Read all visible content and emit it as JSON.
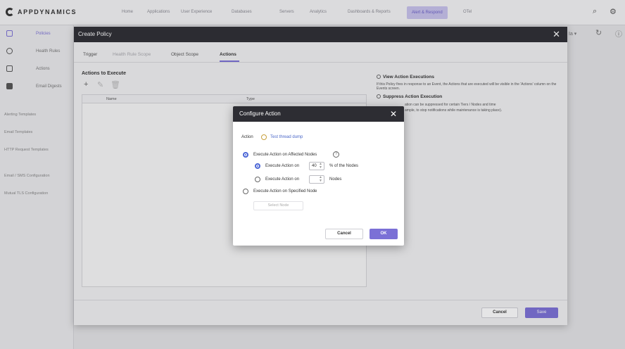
{
  "brand": {
    "name": "APPDYNAMICS"
  },
  "nav": {
    "items": [
      "Home",
      "Applications",
      "User Experience",
      "Databases",
      "Servers",
      "Analytics",
      "Dashboards & Reports",
      "Alert & Respond",
      "OTel"
    ],
    "active": "Alert & Respond",
    "icons": [
      "search-icon",
      "gear-icon"
    ]
  },
  "sidebar": {
    "items": [
      {
        "label": "Policies",
        "icon": "policies-icon",
        "active": true
      },
      {
        "label": "Health Rules",
        "icon": "health-rules-icon"
      },
      {
        "label": "Actions",
        "icon": "actions-icon"
      },
      {
        "label": "Email Digests",
        "icon": "email-digests-icon"
      }
    ],
    "links": [
      "Alerting Templates",
      "Email Templates",
      "HTTP Request Templates",
      "Email / SMS Configuration",
      "Mutual TLS Configuration"
    ],
    "collapse_label": "←"
  },
  "background": {
    "fragment_left": "Ia ▾"
  },
  "create_policy": {
    "title": "Create Policy",
    "close_label": "✕",
    "tabs": [
      "Trigger",
      "Health Rule Scope",
      "Object Scope",
      "Actions"
    ],
    "active_tab": "Actions",
    "actions_title": "Actions to Execute",
    "table_headers": {
      "name": "Name",
      "type": "Type"
    },
    "view_executions_title": "View Action Executions",
    "view_executions_text": "If this Policy fires in response to an Event, the Actions that are executed will be visible in the 'Actions' column on the Events screen.",
    "suppress_title": "Suppress Action Execution",
    "suppress_text_1": "ation can be suppressed for certain Tiers / Nodes and time",
    "suppress_text_2": "ample, to stop notifications while maintenance is taking place).",
    "cancel_label": "Cancel",
    "save_label": "Save"
  },
  "configure_action": {
    "title": "Configure Action",
    "close_label": "✕",
    "action_label": "Action",
    "action_value": "Test thread dump",
    "affected_nodes_label": "Execute Action on Affected Nodes",
    "affected_nodes_selected": true,
    "percent_option_label": "Execute Action on",
    "percent_value": "40",
    "percent_suffix": "% of the Nodes",
    "count_option_label": "Execute Action on",
    "count_value": "",
    "count_suffix": "Nodes",
    "specified_node_label": "Execute Action on Specified Node",
    "select_node_label": "Select Node",
    "cancel_label": "Cancel",
    "ok_label": "OK"
  },
  "colors": {
    "accent": "#7b70d6",
    "header": "#2d2d33",
    "link": "#4a67c8"
  }
}
